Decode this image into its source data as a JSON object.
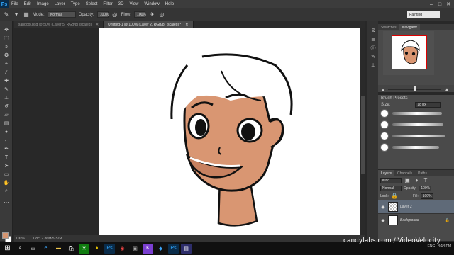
{
  "app": {
    "logo": "Ps",
    "menus": [
      "File",
      "Edit",
      "Image",
      "Layer",
      "Type",
      "Select",
      "Filter",
      "3D",
      "View",
      "Window",
      "Help"
    ],
    "window_controls": [
      "–",
      "□",
      "✕"
    ]
  },
  "options": {
    "mode_label": "Mode:",
    "mode_value": "Normal",
    "opacity_label": "Opacity:",
    "opacity_value": "100%",
    "flow_label": "Flow:",
    "flow_value": "100%",
    "workspace": "Painting"
  },
  "tabs": [
    {
      "label": "sandoor.psd @ 50% (Layer 5, RGB/8) [scaled]",
      "active": false
    },
    {
      "label": "Untitled-1 @ 100% (Layer 2, RGB/8) [scaled] *",
      "active": true
    }
  ],
  "status": {
    "zoom": "100%",
    "doc_size": "Doc: 2.86M/5.32M"
  },
  "colors": {
    "foreground": "#d69570",
    "background": "#ffffff",
    "skin": "#d99672",
    "accent_selected": "#5f6a78"
  },
  "navigator": {
    "tabs": [
      "Swatches",
      "Navigator"
    ],
    "active_tab": "Navigator"
  },
  "brush": {
    "panel_title": "Brush Presets",
    "size_label": "Size:",
    "size_value": "18 px"
  },
  "layers": {
    "tabs": [
      "Layers",
      "Channels",
      "Paths"
    ],
    "kind": "Kind",
    "blend": "Normal",
    "opacity_label": "Opacity:",
    "opacity_value": "100%",
    "lock_label": "Lock:",
    "fill_label": "Fill:",
    "fill_value": "100%",
    "items": [
      {
        "name": "Layer 2",
        "selected": true
      },
      {
        "name": "Background",
        "selected": false
      }
    ]
  },
  "watermark": "candylabs.com / VideoVelocity",
  "tray": {
    "lang": "ENG",
    "time": "4:14 PM"
  }
}
